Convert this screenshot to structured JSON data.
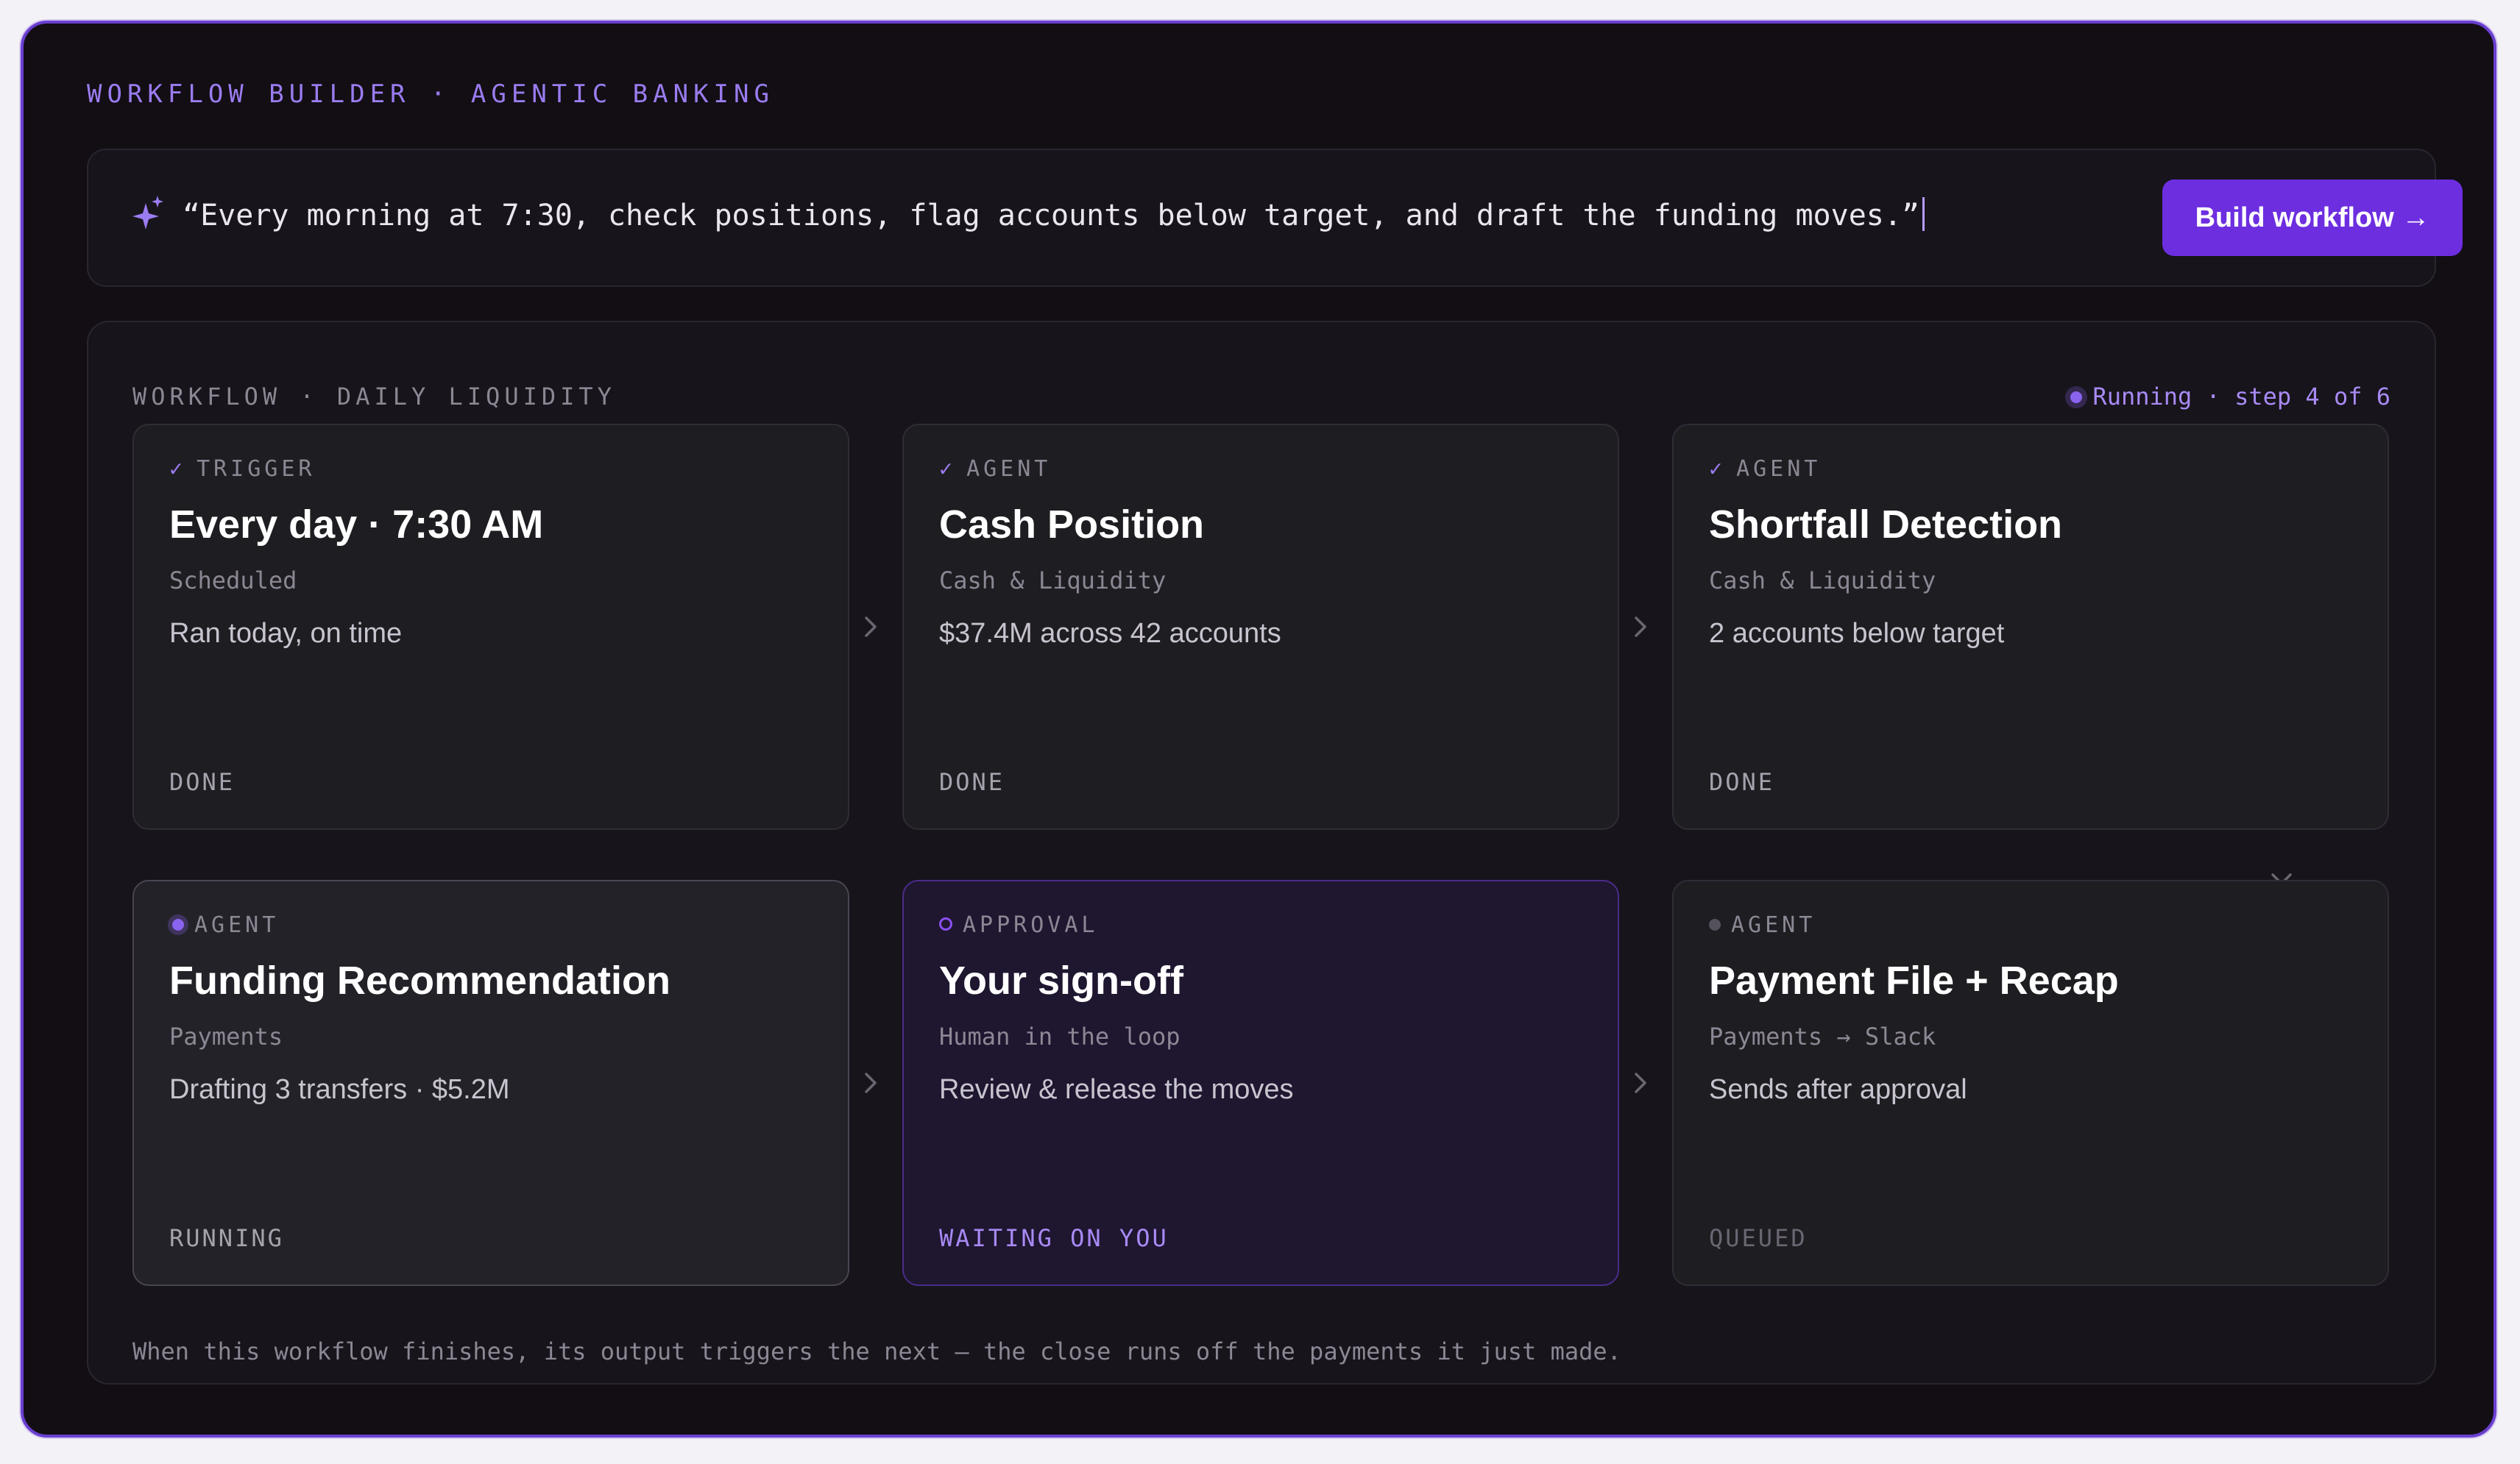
{
  "header": {
    "eyebrow": "WORKFLOW BUILDER · AGENTIC BANKING"
  },
  "prompt": {
    "text": "“Every morning at 7:30, check positions, flag accounts below target, and draft the funding moves.”",
    "icon": "sparkle-icon",
    "button_label": "Build workflow →"
  },
  "workflow": {
    "label": "WORKFLOW · DAILY LIQUIDITY",
    "status": "Running · step 4 of 6",
    "steps": [
      {
        "type": "TRIGGER",
        "title": "Every day · 7:30 AM",
        "subtitle": "Scheduled",
        "detail": "Ran today, on time",
        "state": "DONE"
      },
      {
        "type": "AGENT",
        "title": "Cash Position",
        "subtitle": "Cash & Liquidity",
        "detail": "$37.4M across 42 accounts",
        "state": "DONE"
      },
      {
        "type": "AGENT",
        "title": "Shortfall Detection",
        "subtitle": "Cash & Liquidity",
        "detail": "2 accounts below target",
        "state": "DONE"
      },
      {
        "type": "AGENT",
        "title": "Funding Recommendation",
        "subtitle": "Payments",
        "detail": "Drafting 3 transfers · $5.2M",
        "state": "RUNNING"
      },
      {
        "type": "APPROVAL",
        "title": "Your sign-off",
        "subtitle": "Human in the loop",
        "detail": "Review & release the moves",
        "state": "WAITING ON YOU"
      },
      {
        "type": "AGENT",
        "title": "Payment File + Recap",
        "subtitle": "Payments → Slack",
        "detail": "Sends after approval",
        "state": "QUEUED"
      }
    ],
    "footnote": "When this workflow finishes, its output triggers the next — the close runs off the payments it just made."
  },
  "colors": {
    "accent": "#6d2ee0",
    "accent_light": "#9b7cf0",
    "background": "#120e14",
    "panel": "#17141b",
    "card": "#1e1d21",
    "approval_card": "#1f1630"
  }
}
